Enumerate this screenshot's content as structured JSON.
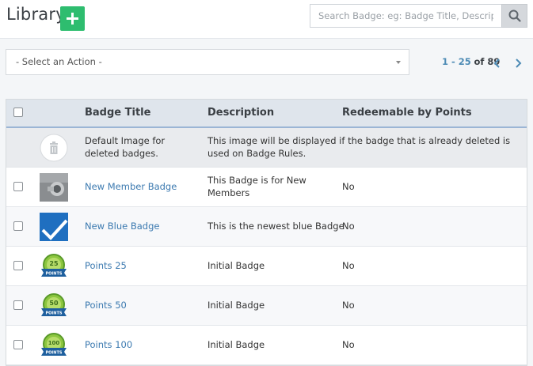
{
  "header": {
    "title": "Library",
    "add_icon": "plus-icon",
    "search": {
      "placeholder": "Search Badge: eg: Badge Title, Description"
    },
    "search_icon": "search-icon"
  },
  "toolbar": {
    "action_select": "- Select an Action -",
    "pager": {
      "range": "1 - 25",
      "of": "of",
      "total": "89"
    }
  },
  "table": {
    "columns": [
      "Badge Title",
      "Description",
      "Redeemable by Points"
    ],
    "deleted_row": {
      "title": "Default Image for deleted badges.",
      "description": "This image will be displayed if the badge that is already deleted is used on Badge Rules."
    },
    "rows": [
      {
        "title": "New Member Badge",
        "description": "This Badge is for New Members",
        "redeemable": "No",
        "thumb": "lock-photo"
      },
      {
        "title": "New Blue Badge",
        "description": "This is the newest blue Badge",
        "redeemable": "No",
        "thumb": "blue-checkmark"
      },
      {
        "title": "Points 25",
        "description": "Initial Badge",
        "redeemable": "No",
        "thumb": "points-badge",
        "badge_number": "25",
        "badge_ribbon": "POINTS"
      },
      {
        "title": "Points 50",
        "description": "Initial Badge",
        "redeemable": "No",
        "thumb": "points-badge",
        "badge_number": "50",
        "badge_ribbon": "POINTS"
      },
      {
        "title": "Points 100",
        "description": "Initial Badge",
        "redeemable": "No",
        "thumb": "points-badge",
        "badge_number": "100",
        "badge_ribbon": "POINTS"
      }
    ]
  },
  "colors": {
    "accent_green": "#2ebd6f",
    "link_blue": "#3c7ab0",
    "header_row": "#dfe5ec"
  }
}
